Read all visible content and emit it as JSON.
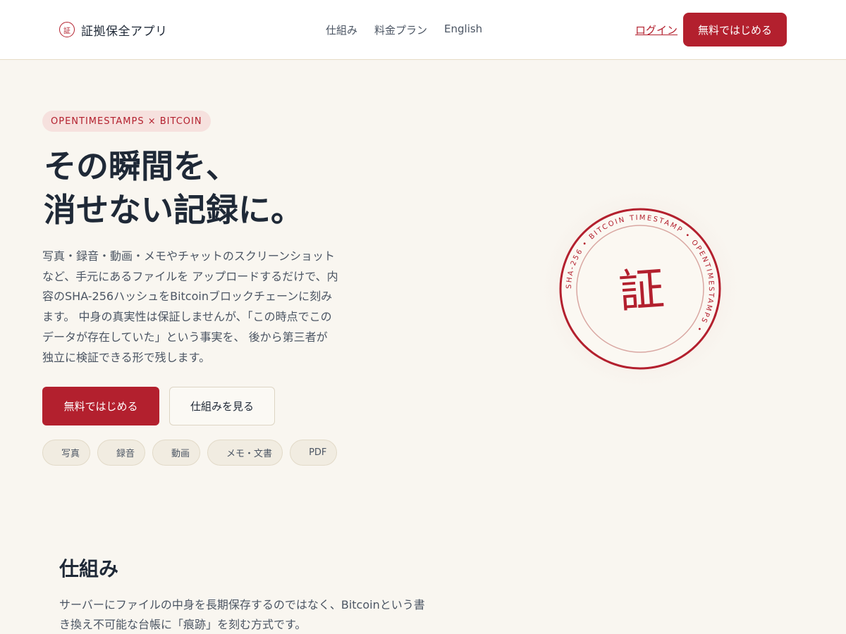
{
  "header": {
    "logo_mark": "証",
    "logo_text": "証拠保全アプリ",
    "nav": [
      "仕組み",
      "料金プラン",
      "English"
    ],
    "login": "ログイン",
    "cta": "無料ではじめる"
  },
  "hero": {
    "eyebrow": "OPENTIMESTAMPS × BITCOIN",
    "headline_line1": "その瞬間を、",
    "headline_line2": "消せない記録に。",
    "body": "写真・録音・動画・メモやチャットのスクリーンショットなど、手元にあるファイルを アップロードするだけで、内容のSHA-256ハッシュをBitcoinブロックチェーンに刻みます。 中身の真実性は保証しませんが、「この時点でこのデータが存在していた」という事実を、 後から第三者が独立に検証できる形で残します。",
    "cta_primary": "無料ではじめる",
    "cta_secondary": "仕組みを見る",
    "chips": [
      "写真",
      "録音",
      "動画",
      "メモ・文書",
      "PDF"
    ]
  },
  "stamp": {
    "center": "証",
    "ring_text": "SHA-256 • BITCOIN TIMESTAMP • OPENTIMESTAMPS •",
    "color": "#b3202e"
  },
  "section": {
    "title": "仕組み",
    "body": "サーバーにファイルの中身を長期保存するのではなく、Bitcoinという書き換え不可能な台帳に「痕跡」を刻む方式です。"
  },
  "colors": {
    "accent": "#b3202e",
    "background": "#f9f6f0"
  }
}
